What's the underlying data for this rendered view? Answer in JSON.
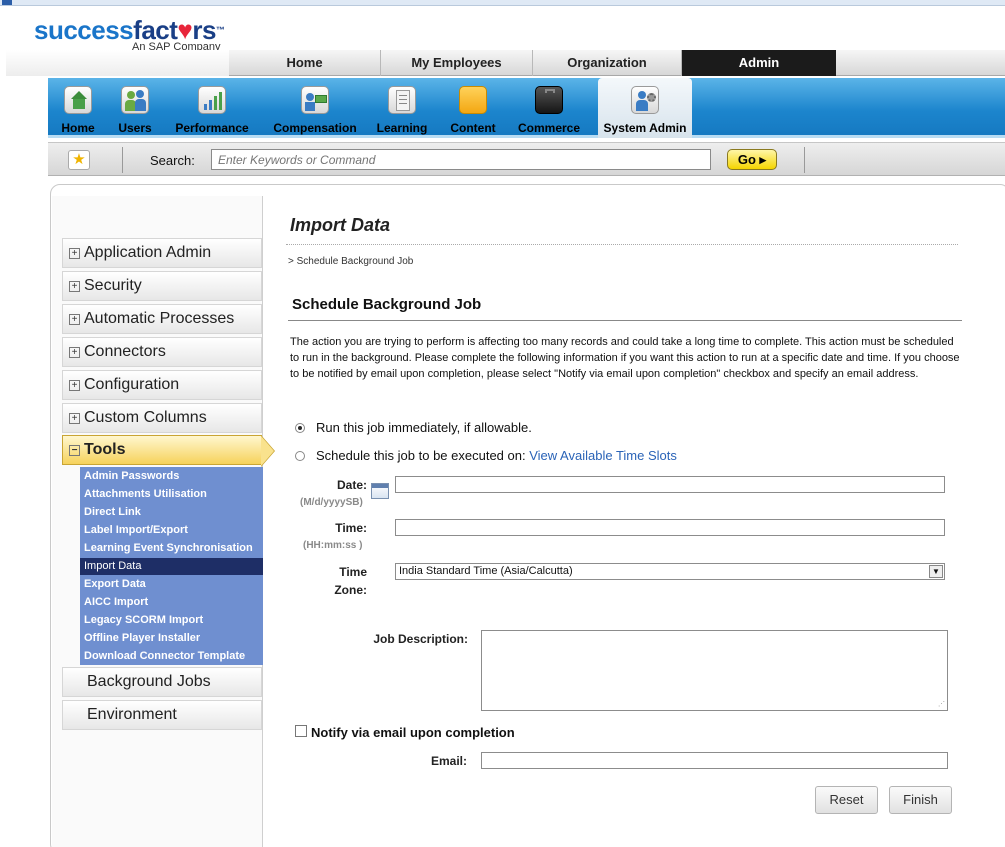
{
  "brand": {
    "logo_part1": "success",
    "logo_part2": "fact",
    "logo_heart": "♥",
    "logo_part3": "rs",
    "logo_tm": "™",
    "tagline": "An SAP Company"
  },
  "main_nav": {
    "tabs": [
      {
        "label": "Home",
        "active": false
      },
      {
        "label": "My Employees",
        "active": false
      },
      {
        "label": "Organization",
        "active": false
      },
      {
        "label": "Admin",
        "active": true
      }
    ]
  },
  "toolbar": {
    "items": [
      {
        "label": "Home",
        "icon": "home-icon"
      },
      {
        "label": "Users",
        "icon": "users-icon"
      },
      {
        "label": "Performance",
        "icon": "performance-icon"
      },
      {
        "label": "Compensation",
        "icon": "compensation-icon"
      },
      {
        "label": "Learning",
        "icon": "learning-icon"
      },
      {
        "label": "Content",
        "icon": "content-folder-icon"
      },
      {
        "label": "Commerce",
        "icon": "commerce-briefcase-icon"
      },
      {
        "label": "System Admin",
        "icon": "system-admin-icon",
        "active": true
      }
    ]
  },
  "search": {
    "label": "Search:",
    "placeholder": "Enter Keywords or Command",
    "go_label": "Go ▸"
  },
  "sidebar": {
    "sections": [
      {
        "label": "Application Admin",
        "expander": "+"
      },
      {
        "label": "Security",
        "expander": "+"
      },
      {
        "label": "Automatic Processes",
        "expander": "+"
      },
      {
        "label": "Connectors",
        "expander": "+"
      },
      {
        "label": "Configuration",
        "expander": "+"
      },
      {
        "label": "Custom Columns",
        "expander": "+"
      }
    ],
    "tools": {
      "label": "Tools",
      "expander": "−",
      "items": [
        "Admin Passwords",
        "Attachments Utilisation",
        "Direct Link",
        "Label Import/Export",
        "Learning Event Synchronisation",
        "Import Data",
        "Export Data",
        "AICC Import",
        "Legacy SCORM Import",
        "Offline Player Installer",
        "Download Connector Template"
      ],
      "selected_index": 5
    },
    "after": [
      {
        "label": "Background Jobs"
      },
      {
        "label": "Environment"
      }
    ]
  },
  "page": {
    "title": "Import Data",
    "breadcrumb": "> Schedule Background Job",
    "section_title": "Schedule Background Job",
    "description": "The action you are trying to perform is affecting too many records and could take a long time to complete. This action must be scheduled to run in the background. Please complete the following information if you want this action to run at a specific date and time. If you choose to be notified by email upon completion, please select \"Notify via email upon completion\" checkbox and specify an email address."
  },
  "form": {
    "run_now_label": "Run this job immediately, if allowable.",
    "run_now_selected": true,
    "schedule_label": "Schedule this job to be executed on:",
    "schedule_link": "View Available Time Slots",
    "date_label": "Date:",
    "date_hint": "(M/d/yyyySB)",
    "date_value": "",
    "time_label": "Time:",
    "time_hint": "(HH:mm:ss )",
    "time_value": "",
    "timezone_label_1": "Time",
    "timezone_label_2": "Zone:",
    "timezone_value": "India Standard Time (Asia/Calcutta)",
    "job_description_label": "Job Description:",
    "job_description_value": "",
    "notify_label": "Notify via email upon completion",
    "notify_checked": false,
    "email_label": "Email:",
    "email_value": "",
    "reset_label": "Reset",
    "finish_label": "Finish"
  }
}
